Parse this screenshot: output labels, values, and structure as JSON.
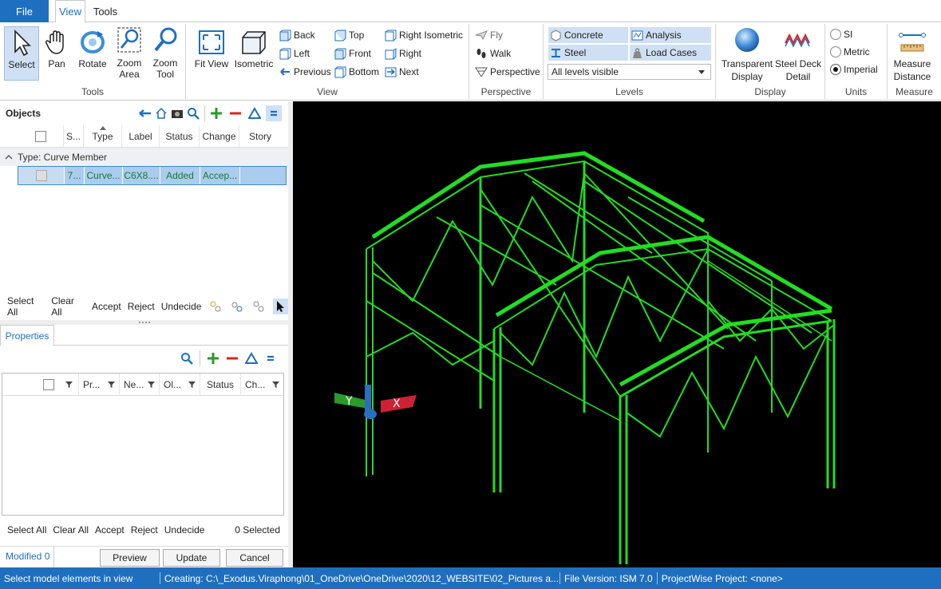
{
  "menu": {
    "file": "File",
    "view": "View",
    "tools": "Tools"
  },
  "ribbon": {
    "tools": {
      "label": "Tools",
      "select": "Select",
      "pan": "Pan",
      "rotate": "Rotate",
      "zoom_area": [
        "Zoom",
        "Area"
      ],
      "zoom_tool": [
        "Zoom",
        "Tool"
      ]
    },
    "view": {
      "label": "View",
      "fit_view": "Fit View",
      "isometric": "Isometric",
      "back": "Back",
      "left": "Left",
      "previous": "Previous",
      "top": "Top",
      "front": "Front",
      "bottom": "Bottom",
      "right_isometric": "Right Isometric",
      "right": "Right",
      "next": "Next"
    },
    "perspective": {
      "label": "Perspective",
      "fly": "Fly",
      "walk": "Walk",
      "perspective": "Perspective"
    },
    "levels": {
      "label": "Levels",
      "concrete": "Concrete",
      "analysis": "Analysis",
      "steel": "Steel",
      "load_cases": "Load Cases",
      "dropdown_value": "All levels visible"
    },
    "display": {
      "label": "Display",
      "transparent": [
        "Transparent",
        "Display"
      ],
      "steel_deck": [
        "Steel Deck",
        "Detail"
      ]
    },
    "units": {
      "label": "Units",
      "si": "SI",
      "metric": "Metric",
      "imperial": "Imperial",
      "selected": "Imperial"
    },
    "measure": {
      "label": "Measure",
      "measure_distance": [
        "Measure",
        "Distance"
      ]
    }
  },
  "objects": {
    "title": "Objects",
    "columns": [
      "S...",
      "Type",
      "Label",
      "Status",
      "Change",
      "Story"
    ],
    "group": "Type: Curve Member",
    "rows": [
      {
        "s": "7...",
        "type": "Curve...",
        "label": "C6X8....",
        "status": "Added",
        "change": "Accep...",
        "story": ""
      }
    ],
    "actions": {
      "select_all": "Select All",
      "clear_all": "Clear All",
      "accept": "Accept",
      "reject": "Reject",
      "undecide": "Undecide"
    }
  },
  "properties": {
    "tab": "Properties",
    "columns": [
      "Pr...",
      "Ne...",
      "Ol...",
      "Status",
      "Ch..."
    ],
    "actions": {
      "select_all": "Select All",
      "clear_all": "Clear All",
      "accept": "Accept",
      "reject": "Reject",
      "undecide": "Undecide",
      "selected_count": "0 Selected"
    }
  },
  "bottom": {
    "modified": "Modified 0",
    "preview": "Preview",
    "update": "Update",
    "cancel": "Cancel"
  },
  "status": {
    "hint": "Select model elements in view",
    "creating": "Creating:  C:\\_Exodus.Viraphong\\01_OneDrive\\OneDrive\\2020\\12_WEBSITE\\02_Pictures  a...",
    "file_version": "File Version: ISM 7.0",
    "projectwise": "ProjectWise Project: <none>"
  },
  "colors": {
    "accent": "#1e6fbf",
    "model": "#22dd22",
    "viewport_bg": "#000000"
  }
}
